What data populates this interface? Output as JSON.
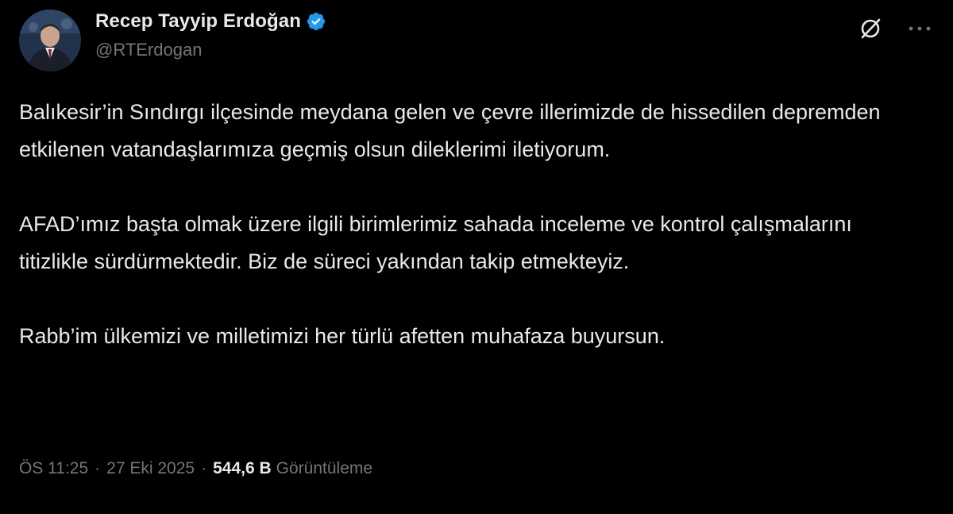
{
  "tweet": {
    "author": {
      "display_name": "Recep Tayyip Erdoğan",
      "handle": "@RTErdogan",
      "verified": true
    },
    "paragraphs": [
      "Balıkesir’in Sındırgı ilçesinde meydana gelen ve çevre illerimizde de hissedilen depremden etkilenen vatandaşlarımıza geçmiş olsun dileklerimi iletiyorum.",
      "AFAD’ımız başta olmak üzere ilgili birimlerimiz sahada inceleme ve kontrol çalışmalarını titizlikle sürdürmektedir. Biz de süreci yakından takip etmekteyiz.",
      "Rabb’im ülkemizi ve milletimizi her türlü afetten muhafaza buyursun."
    ],
    "time": "ÖS 11:25",
    "separator": "·",
    "date": "27 Eki 2025",
    "views_count": "544,6 B",
    "views_label": "Görüntüleme"
  },
  "icons": {
    "verified": "verified-badge-icon",
    "grok": "grok-icon",
    "more": "more-icon"
  },
  "colors": {
    "background": "#000000",
    "primary_text": "#e7e9ea",
    "secondary_text": "#71767b",
    "verified_blue": "#1d9bf0"
  }
}
